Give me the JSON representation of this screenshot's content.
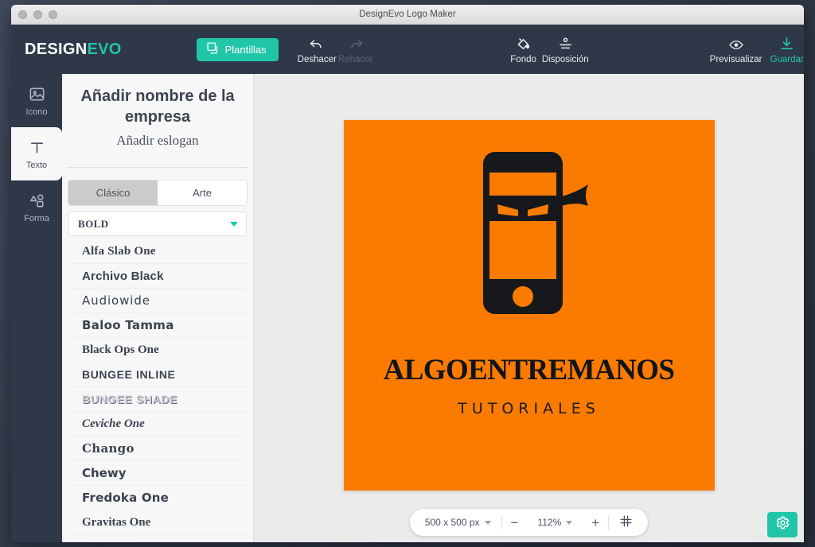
{
  "window": {
    "title": "DesignEvo Logo Maker",
    "traffic_lights": [
      "close-button",
      "minimize-button",
      "maximize-button"
    ]
  },
  "topbar": {
    "brand_part1": "DESIGN",
    "brand_part2": "EVO",
    "templates_label": "Plantillas",
    "templates_icon": "layers-icon",
    "accent_color": "#21c6a9",
    "background_color": "#2e3848",
    "tools": [
      {
        "id": "undo",
        "label": "Deshacer",
        "icon": "undo-arrow-icon",
        "disabled": false
      },
      {
        "id": "redo",
        "label": "Rehacer",
        "icon": "redo-arrow-icon",
        "disabled": true
      },
      {
        "id": "fondo",
        "label": "Fondo",
        "icon": "paint-bucket-icon",
        "disabled": false
      },
      {
        "id": "dispo",
        "label": "Disposición",
        "icon": "align-icon",
        "disabled": false
      },
      {
        "id": "preview",
        "label": "Previsualizar",
        "icon": "eye-icon",
        "disabled": false
      },
      {
        "id": "save",
        "label": "Guardar",
        "icon": "download-icon",
        "disabled": false
      }
    ]
  },
  "rail": {
    "items": [
      {
        "id": "icono",
        "label": "Icono",
        "icon": "image-icon",
        "active": false
      },
      {
        "id": "texto",
        "label": "Texto",
        "icon": "text-t-icon",
        "active": true
      },
      {
        "id": "forma",
        "label": "Forma",
        "icon": "shapes-icon",
        "active": false
      }
    ]
  },
  "panel": {
    "company_name": "Añadir nombre de la empresa",
    "slogan": "Añadir eslogan",
    "tabs": [
      {
        "label": "Clásico",
        "active": true
      },
      {
        "label": "Arte",
        "active": false
      }
    ],
    "font_select_value": "BOLD",
    "font_select_caret": "chevron-down-icon",
    "fonts": [
      {
        "name": "Alfa Slab One",
        "style": "f-slab"
      },
      {
        "name": "Archivo Black",
        "style": "f-black"
      },
      {
        "name": "Audiowide",
        "style": "f-wide"
      },
      {
        "name": "Baloo Tamma",
        "style": "f-round"
      },
      {
        "name": "Black Ops One",
        "style": "f-stencil"
      },
      {
        "name": "BUNGEE INLINE",
        "style": "f-inline"
      },
      {
        "name": "BUNGEE SHADE",
        "style": "f-shade"
      },
      {
        "name": "Ceviche One",
        "style": "f-italic"
      },
      {
        "name": "Chango",
        "style": "f-chango"
      },
      {
        "name": "Chewy",
        "style": "f-chewy"
      },
      {
        "name": "Fredoka One",
        "style": "f-fredoka"
      },
      {
        "name": "Gravitas One",
        "style": "f-grav"
      }
    ]
  },
  "canvas": {
    "background_color": "#fa7b00",
    "logo_mark_icon": "ninja-phone-icon",
    "logo_title": "ALGOENTREMANOS",
    "logo_subtitle": "TUTORIALES"
  },
  "bottombar": {
    "canvas_size": "500 x 500 px",
    "zoom_out_label": "−",
    "zoom_level": "112%",
    "zoom_in_label": "+",
    "grid_icon": "grid-icon",
    "settings_icon": "gear-icon"
  }
}
